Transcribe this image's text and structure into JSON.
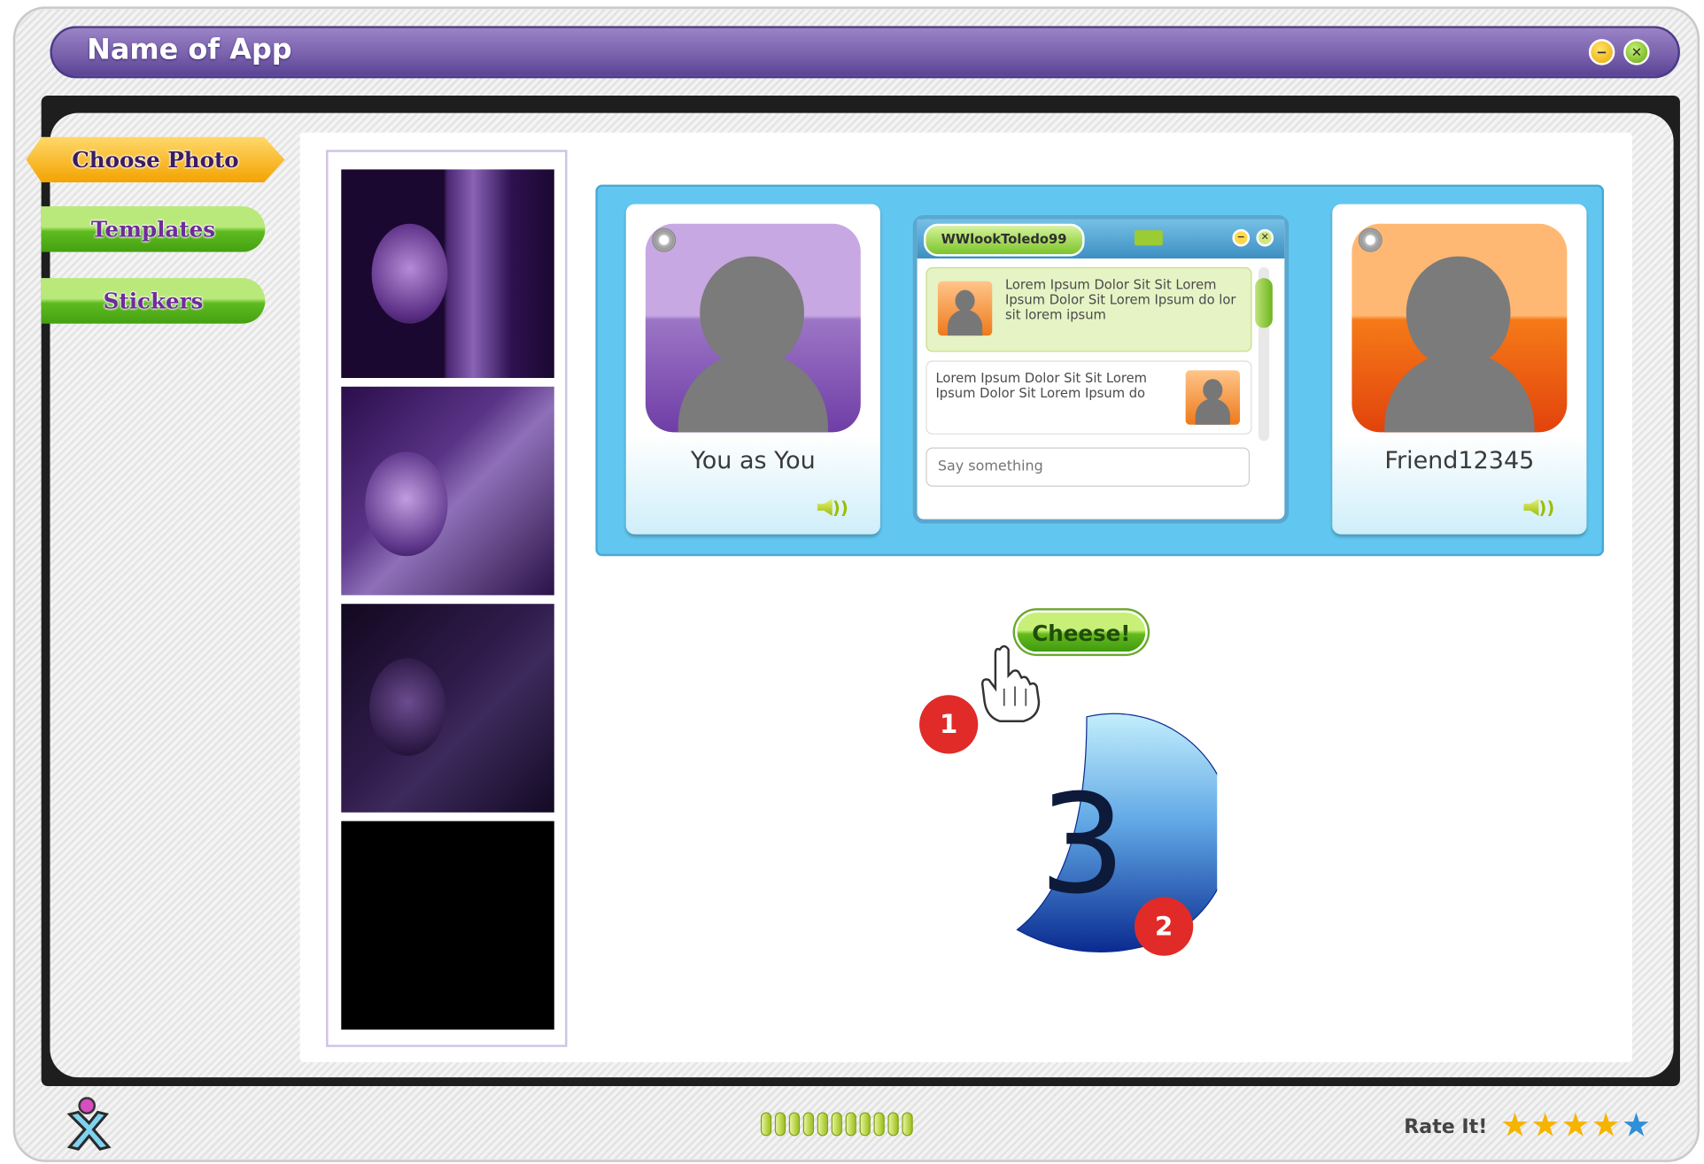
{
  "window": {
    "title": "Name of App",
    "minimize_glyph": "−",
    "close_glyph": "✕"
  },
  "sidebar": {
    "items": [
      {
        "label": "Choose Photo",
        "active": true
      },
      {
        "label": "Templates",
        "active": false
      },
      {
        "label": "Stickers",
        "active": false
      }
    ]
  },
  "photo_strip": {
    "frames": 4
  },
  "video_chat": {
    "you": {
      "name": "You as You"
    },
    "friend": {
      "name": "Friend12345"
    },
    "chat": {
      "username": "WWlookToledo99",
      "messages": [
        {
          "text": "Lorem Ipsum Dolor Sit Sit Lorem Ipsum Dolor Sit Lorem Ipsum do lor sit lorem ipsum",
          "side": "left"
        },
        {
          "text": "Lorem Ipsum Dolor Sit Sit Lorem Ipsum Dolor Sit Lorem Ipsum do",
          "side": "right"
        }
      ],
      "input_placeholder": "Say something"
    }
  },
  "capture": {
    "button_label": "Cheese!",
    "countdown": "3"
  },
  "annotations": [
    "1",
    "2"
  ],
  "footer": {
    "rate_label": "Rate It!",
    "rating": 5,
    "progress_segments": 11
  },
  "colors": {
    "title_bar": "#7a62ad",
    "chat_panel": "#62c7f0",
    "accent_green": "#64bb1c",
    "accent_orange": "#f3a300",
    "marker_red": "#e02b28"
  }
}
